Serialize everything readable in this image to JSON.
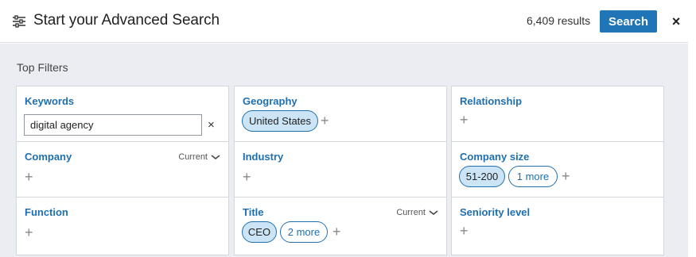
{
  "header": {
    "title": "Start your Advanced Search",
    "results": "6,409 results",
    "search_label": "Search",
    "close_label": "×",
    "filter_icon": "sliders-icon"
  },
  "section_label": "Top Filters",
  "filters": {
    "keywords": {
      "label": "Keywords",
      "value": "digital agency",
      "clear": "×"
    },
    "company": {
      "label": "Company",
      "scope": "Current",
      "add": "+"
    },
    "function": {
      "label": "Function",
      "add": "+"
    },
    "geography": {
      "label": "Geography",
      "selected": "United States",
      "add": "+"
    },
    "industry": {
      "label": "Industry",
      "add": "+"
    },
    "title": {
      "label": "Title",
      "scope": "Current",
      "selected": "CEO",
      "more": "2 more",
      "add": "+"
    },
    "relationship": {
      "label": "Relationship",
      "add": "+"
    },
    "company_size": {
      "label": "Company size",
      "selected": "51-200",
      "more": "1 more",
      "add": "+"
    },
    "seniority": {
      "label": "Seniority level",
      "add": "+"
    }
  },
  "colors": {
    "accent": "#1f75b5",
    "pill_bg": "#cce5f6",
    "panel_bg": "#ebedf3"
  }
}
